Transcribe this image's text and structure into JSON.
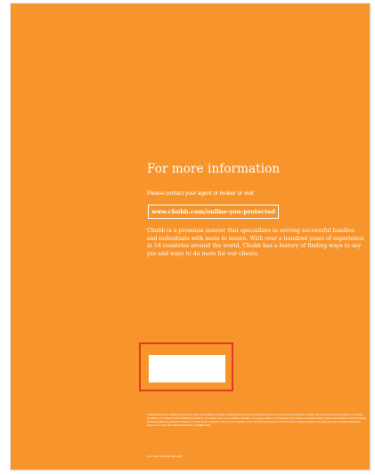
{
  "back_cover": {
    "heading": "For more information",
    "contact_text": "Please contact your agent or broker or visit",
    "url": "www.chubb.com/online-you-protected",
    "about_text": "Chubb is a premium insurer that specializes in serving successful families and individuals with more to insure. With over a hundred years of experience in 54 countries around the world, Chubb has a history of finding ways to say yes and ways to do more for our clients.",
    "legal_text": "© 2020 Chubb is the marketing name used to refer to subsidiaries of Chubb Limited providing insurance and related services. For a list of these subsidiaries, please visit our website at www.chubb.com. Insurance provided by U.S. based Chubb underwriting companies. All products may not be available in all states. Coverage is subject to the language of the policies as actually issued. Surplus lines insurance sold only through licensed surplus lines producers. Whether or to what extent a particular loss is covered depends on the facts and circumstances of the loss and the actual coverage of the policy as issued. Chubb Personal Risk Services, P.O. Box 1600, Whitehouse Station, NJ 08889-1600.",
    "form_code": "Form code: 02-10-0910 (Ed. 9/20)"
  },
  "colors": {
    "page_background": "#f7952c",
    "text": "#ffffff",
    "highlight_border": "#e03b1f"
  }
}
